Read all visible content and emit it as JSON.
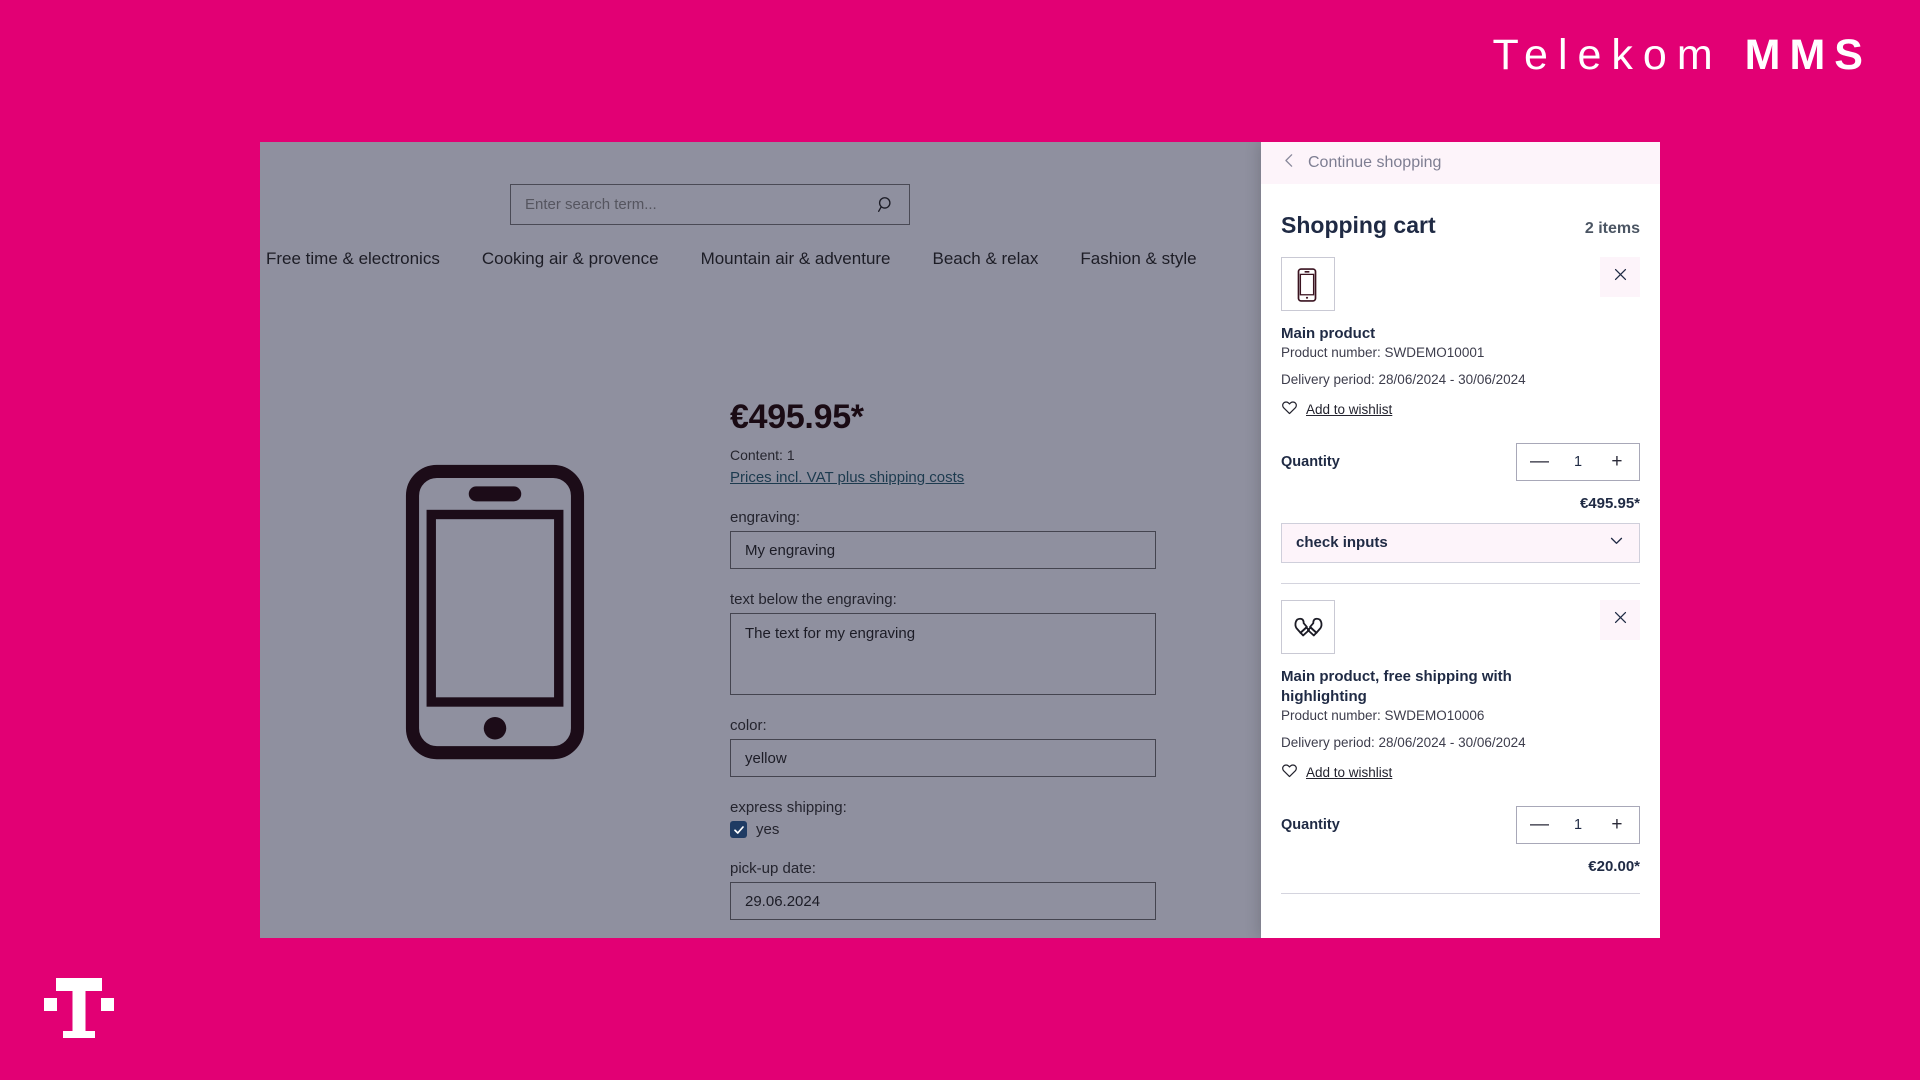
{
  "brand": {
    "name_light": "Telekom",
    "name_bold": "MMS",
    "magenta": "#e20074",
    "logo_icon": "telekom-t-logo"
  },
  "shop": {
    "search": {
      "placeholder": "Enter search term...",
      "icon": "search-icon"
    },
    "header_icons": [
      {
        "name": "wishlist-heart-icon",
        "glyph": "heart"
      },
      {
        "name": "account-person-icon",
        "glyph": "person"
      }
    ],
    "nav": [
      {
        "label": "Free time & electronics"
      },
      {
        "label": "Cooking air & provence"
      },
      {
        "label": "Mountain air & adventure"
      },
      {
        "label": "Beach & relax"
      },
      {
        "label": "Fashion & style"
      }
    ]
  },
  "product": {
    "gallery_icon": "smartphone-icon",
    "price": "€495.95*",
    "content": "Content: 1",
    "vat_link": "Prices incl. VAT plus shipping costs",
    "fields": [
      {
        "name": "engraving",
        "label": "engraving:",
        "value": "My engraving",
        "type": "text"
      },
      {
        "name": "text-below-engraving",
        "label": "text below the engraving:",
        "value": "The text for my engraving",
        "type": "textarea"
      },
      {
        "name": "color",
        "label": "color:",
        "value": "yellow",
        "type": "text"
      }
    ],
    "express_shipping": {
      "label": "express shipping:",
      "option_label": "yes",
      "checked": true,
      "check_color": "#1f3b63"
    },
    "pickup_date": {
      "label": "pick-up date:",
      "value": "29.06.2024"
    }
  },
  "cart": {
    "back_label": "Continue shopping",
    "back_icon": "chevron-left-icon",
    "title": "Shopping cart",
    "count_label": "2 items",
    "quantity_label": "Quantity",
    "wishlist_label": "Add to wishlist",
    "wishlist_icon": "heart-outline-icon",
    "remove_icon": "close-x-icon",
    "minus_label": "—",
    "plus_label": "+",
    "items": [
      {
        "thumb_icon": "smartphone-icon",
        "name": "Main product",
        "product_number": "Product number: SWDEMO10001",
        "delivery": "Delivery period: 28/06/2024 - 30/06/2024",
        "quantity": "1",
        "price": "€495.95*",
        "select": {
          "label": "check inputs",
          "icon": "chevron-down-icon"
        }
      },
      {
        "thumb_icon": "mittens-gloves-icon",
        "name": "Main product, free shipping with highlighting",
        "product_number": "Product number: SWDEMO10006",
        "delivery": "Delivery period: 28/06/2024 - 30/06/2024",
        "quantity": "1",
        "price": "€20.00*"
      }
    ]
  }
}
